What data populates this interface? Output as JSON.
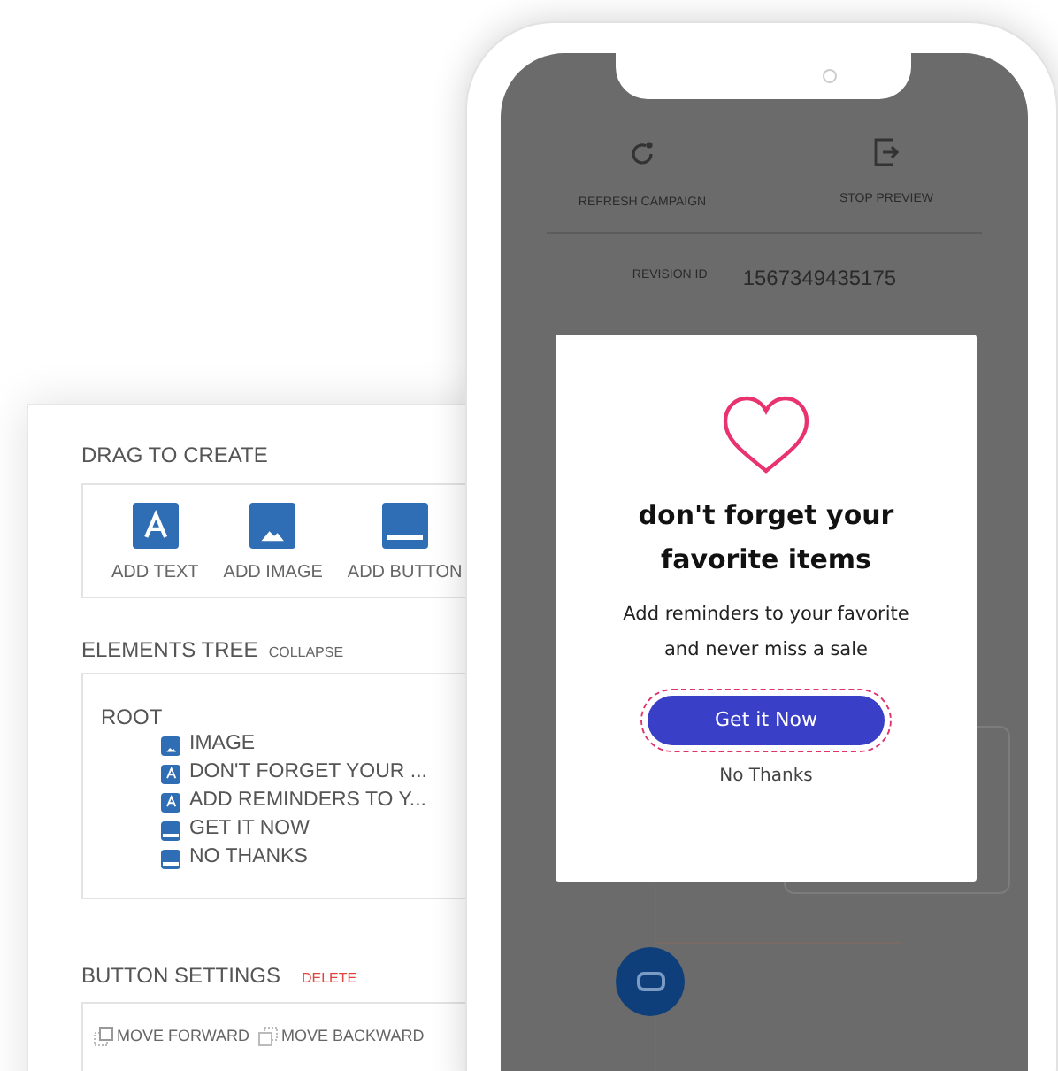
{
  "builder": {
    "drag_to_create": {
      "title": "DRAG TO CREATE",
      "items": [
        {
          "kind": "text",
          "label": "ADD TEXT"
        },
        {
          "kind": "image",
          "label": "ADD IMAGE"
        },
        {
          "kind": "button",
          "label": "ADD BUTTON"
        }
      ]
    },
    "elements_tree": {
      "title": "ELEMENTS TREE",
      "action": "COLLAPSE",
      "root": {
        "label": "ROOT",
        "children": [
          {
            "kind": "image",
            "label": "IMAGE"
          },
          {
            "kind": "text",
            "label": "DON'T FORGET YOUR ..."
          },
          {
            "kind": "text",
            "label": "ADD REMINDERS TO Y..."
          },
          {
            "kind": "button",
            "label": "GET IT NOW"
          },
          {
            "kind": "button",
            "label": "NO THANKS"
          }
        ]
      }
    },
    "button_settings": {
      "title": "BUTTON SETTINGS",
      "action": "DELETE",
      "controls": [
        {
          "kind": "forward",
          "label": "MOVE FORWARD"
        },
        {
          "kind": "backward",
          "label": "MOVE BACKWARD"
        }
      ]
    }
  },
  "preview": {
    "toolbar": [
      {
        "kind": "refresh",
        "label": "REFRESH CAMPAIGN"
      },
      {
        "kind": "stop",
        "label": "STOP PREVIEW"
      }
    ],
    "revision": {
      "label": "REVISION ID",
      "value": "1567349435175"
    },
    "popup": {
      "title": "don't forget your favorite items",
      "body": "Add reminders to your favorite and never miss a sale",
      "primary": "Get it Now",
      "secondary": "No Thanks"
    }
  }
}
